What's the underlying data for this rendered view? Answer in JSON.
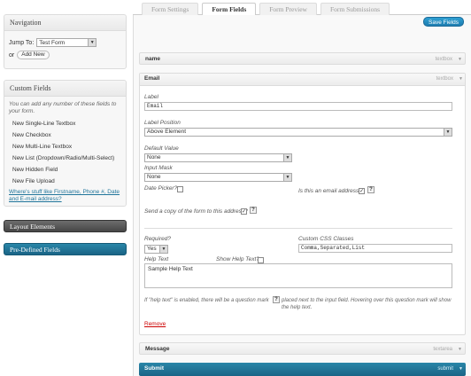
{
  "tabs": [
    "Form Settings",
    "Form Fields",
    "Form Preview",
    "Form Submissions"
  ],
  "active_tab": "Form Fields",
  "navigation": {
    "title": "Navigation",
    "jump_to_label": "Jump To:",
    "jump_to_value": "Test Form",
    "or_label": "or",
    "add_new": "Add New"
  },
  "custom_fields": {
    "title": "Custom Fields",
    "description": "You can add any number of these fields to your form.",
    "buttons": [
      "New Single-Line Textbox",
      "New Checkbox",
      "New Multi-Line Textbox",
      "New List (Dropdown/Radio/Multi-Select)",
      "New Hidden Field",
      "New File Upload"
    ],
    "link": "Where's stuff like Firstname, Phone #, Date and E-mail address?"
  },
  "layout_elements": "Layout Elements",
  "predefined_fields": "Pre-Defined Fields",
  "save_button": "Save Fields",
  "fields": {
    "name": {
      "title": "name",
      "type": "textbox"
    },
    "email": {
      "title": "Email",
      "type": "textbox"
    },
    "message": {
      "title": "Message",
      "type": "textarea"
    },
    "submit": {
      "title": "Submit",
      "type": "submit"
    }
  },
  "email_form": {
    "label_label": "Label",
    "label_value": "Email",
    "label_position_label": "Label Position",
    "label_position_value": "Above Element",
    "default_value_label": "Default Value",
    "default_value_value": "None",
    "input_mask_label": "Input Mask",
    "input_mask_value": "None",
    "date_picker_label": "Date Picker?",
    "is_email_label": "Is this an email address?",
    "send_copy_label": "Send a copy of the form to this address?",
    "required_label": "Required?",
    "required_value": "Yes",
    "css_label": "Custom CSS Classes",
    "css_value": "Comma,Separated,List",
    "help_text_label": "Help Text",
    "show_help_label": "Show Help Text?",
    "help_text_value": "Sample Help Text",
    "note_part1": "If \"help text\" is enabled, there will be a question mark",
    "note_part2": "placed next to the input field. Hovering over this question mark will show the help text.",
    "remove": "Remove",
    "help_glyph": "?",
    "check_glyph": "✓"
  }
}
